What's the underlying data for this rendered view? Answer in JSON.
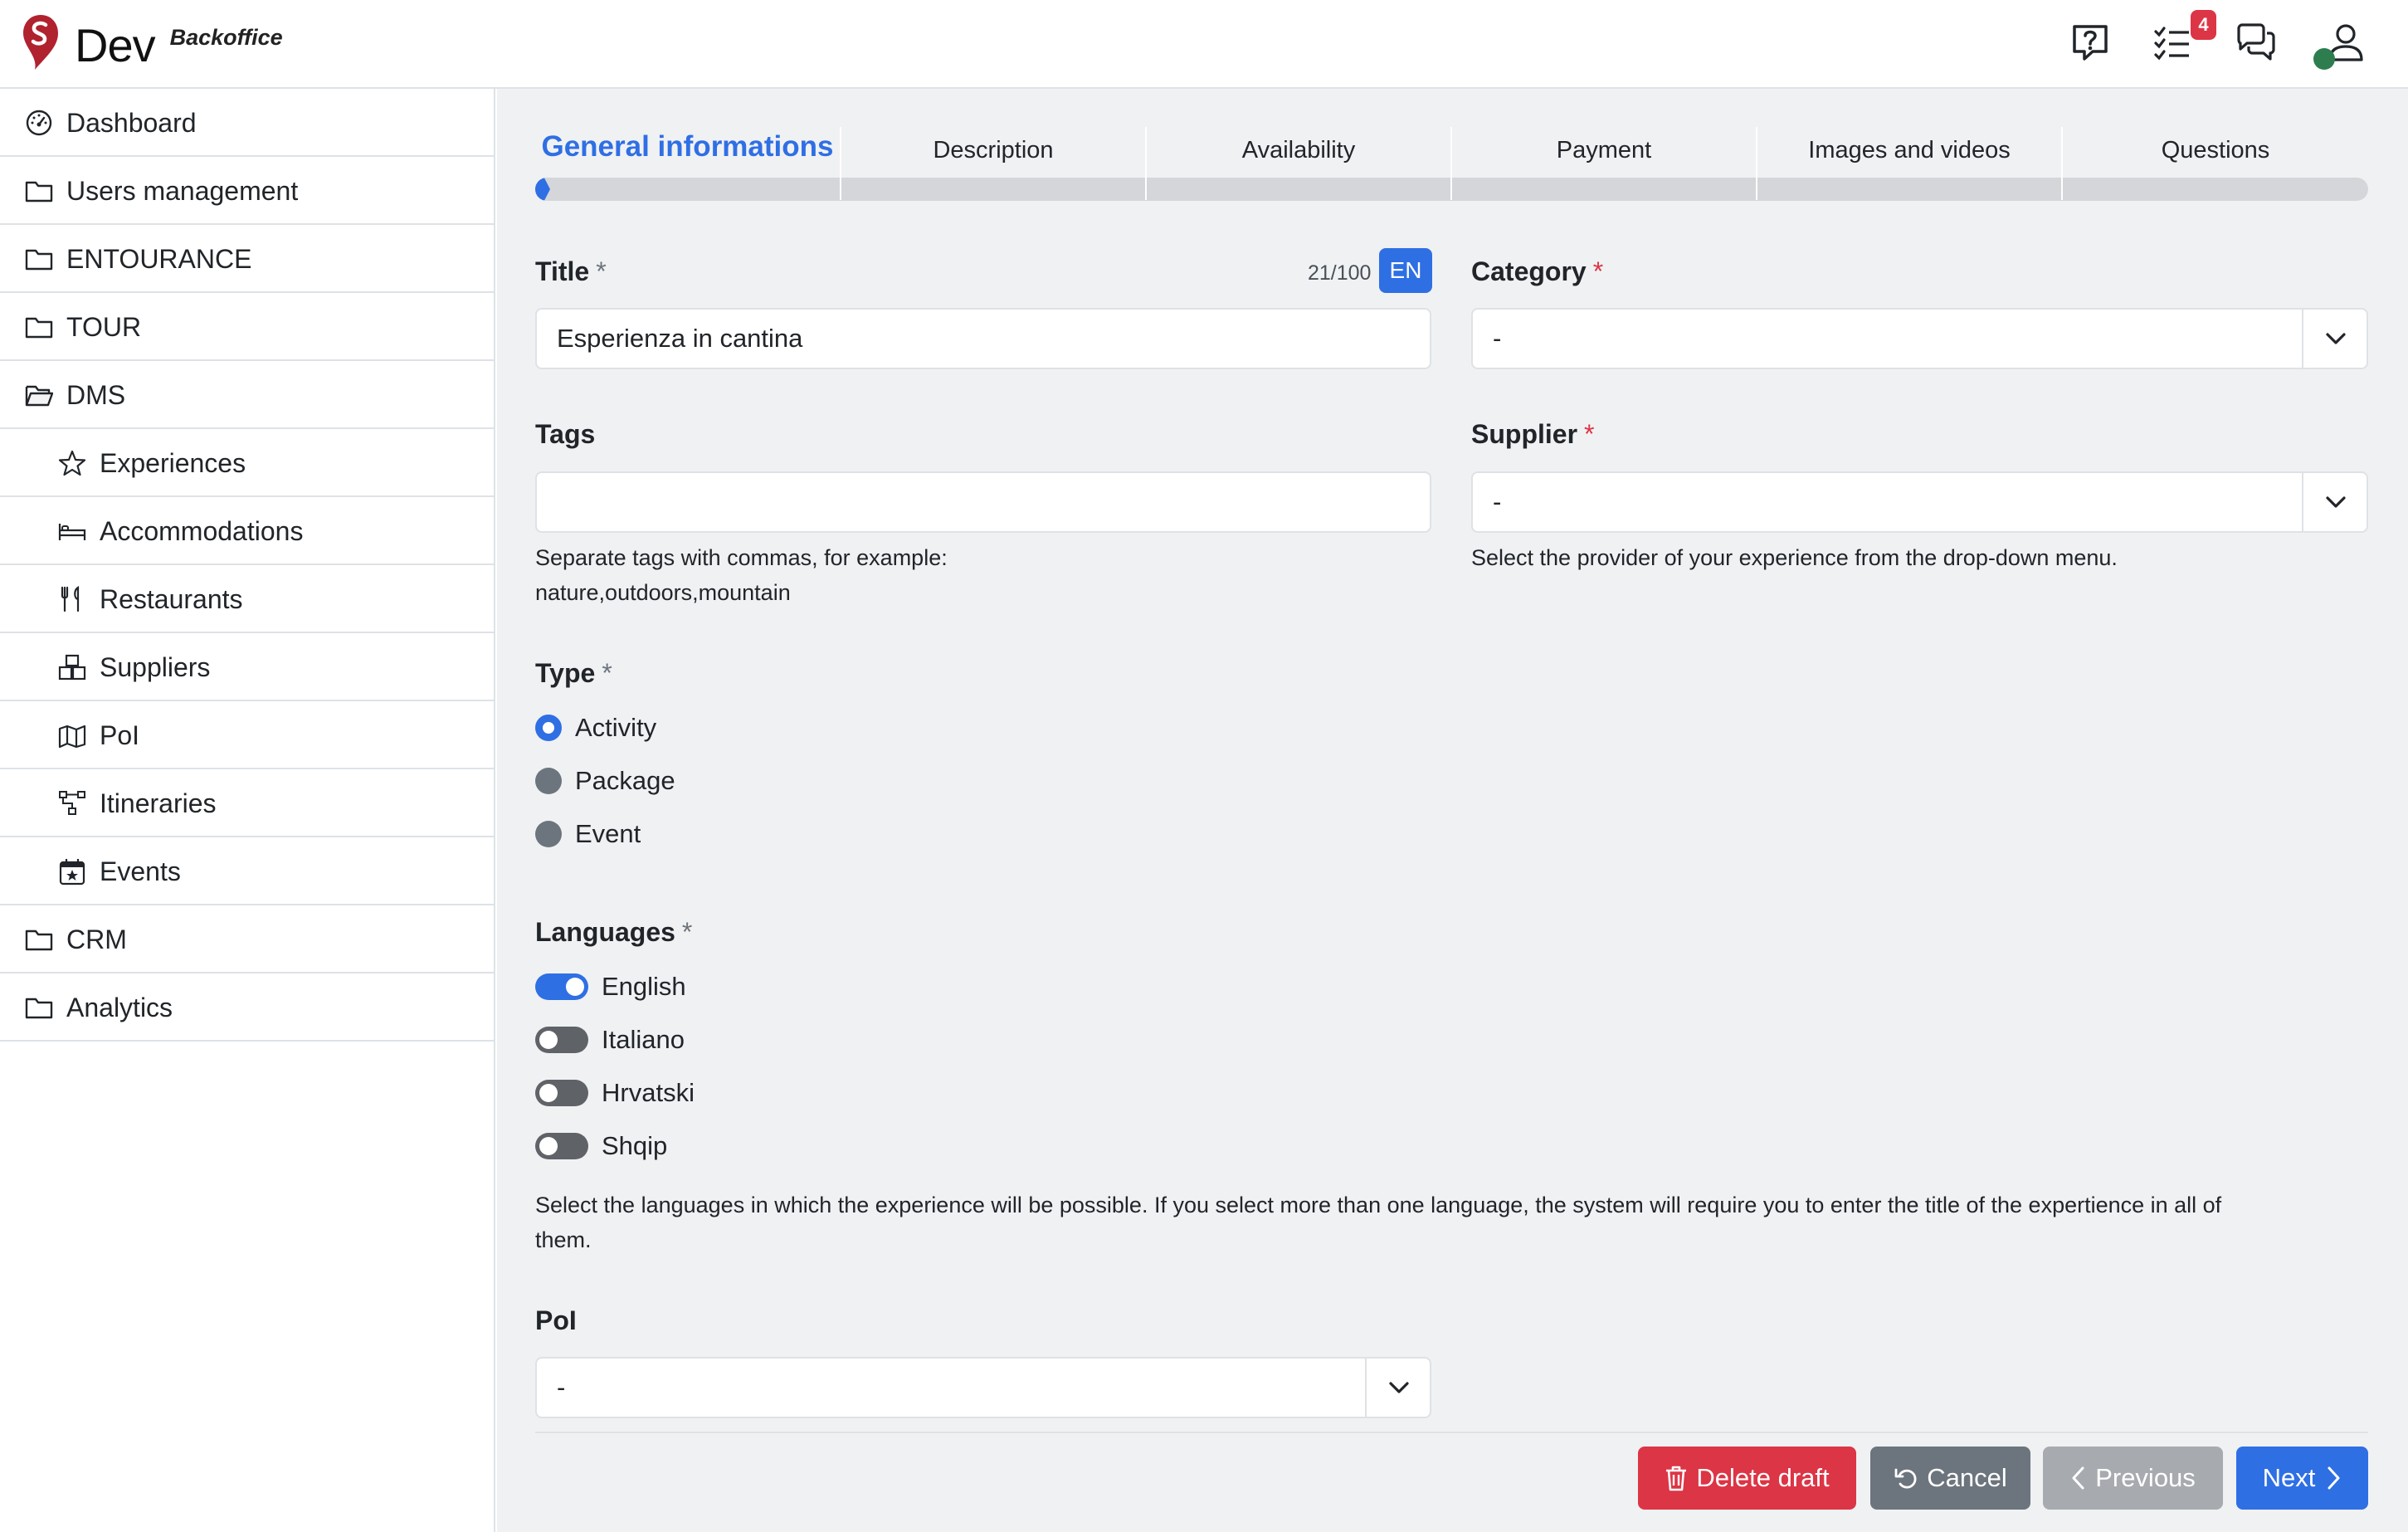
{
  "header": {
    "app_name": "Dev",
    "app_subtitle": "Backoffice",
    "notifications_count": "4",
    "icons": [
      "help-icon",
      "tasks-icon",
      "chat-icon",
      "user-icon"
    ]
  },
  "sidebar": {
    "items": [
      {
        "label": "Dashboard",
        "icon": "speedometer-icon"
      },
      {
        "label": "Users management",
        "icon": "folder-icon"
      },
      {
        "label": "ENTOURANCE",
        "icon": "folder-icon"
      },
      {
        "label": "TOUR",
        "icon": "folder-icon"
      },
      {
        "label": "DMS",
        "icon": "folder-open-icon"
      },
      {
        "label": "Experiences",
        "icon": "star-icon"
      },
      {
        "label": "Accommodations",
        "icon": "bed-icon"
      },
      {
        "label": "Restaurants",
        "icon": "cutlery-icon"
      },
      {
        "label": "Suppliers",
        "icon": "boxes-icon"
      },
      {
        "label": "PoI",
        "icon": "map-icon"
      },
      {
        "label": "Itineraries",
        "icon": "diagram-icon"
      },
      {
        "label": "Events",
        "icon": "calendar-star-icon"
      },
      {
        "label": "CRM",
        "icon": "folder-icon"
      },
      {
        "label": "Analytics",
        "icon": "folder-icon"
      }
    ]
  },
  "tabs": [
    {
      "label": "General informations",
      "active": true
    },
    {
      "label": "Description"
    },
    {
      "label": "Availability"
    },
    {
      "label": "Payment"
    },
    {
      "label": "Images and videos"
    },
    {
      "label": "Questions"
    }
  ],
  "form": {
    "title": {
      "label": "Title",
      "required": "*",
      "counter": "21/100",
      "lang": "EN",
      "value": "Esperienza in cantina"
    },
    "category": {
      "label": "Category",
      "required": "*",
      "value": "-"
    },
    "tags": {
      "label": "Tags",
      "value": "",
      "hint_line1": "Separate tags with commas, for example:",
      "hint_line2": "nature,outdoors,mountain"
    },
    "supplier": {
      "label": "Supplier",
      "required": "*",
      "value": "-",
      "hint": "Select the provider of your experience from the drop-down menu."
    },
    "type": {
      "label": "Type",
      "required": "*",
      "options": [
        "Activity",
        "Package",
        "Event"
      ],
      "selected": "Activity"
    },
    "languages": {
      "label": "Languages",
      "required": "*",
      "options": [
        {
          "label": "English",
          "on": true
        },
        {
          "label": "Italiano",
          "on": false
        },
        {
          "label": "Hrvatski",
          "on": false
        },
        {
          "label": "Shqip",
          "on": false
        }
      ],
      "hint_line1": "Select the languages in which the experience will be possible. If you select more than one language, the system will require you to enter the title of the expertience in all of",
      "hint_line2": "them."
    },
    "poi": {
      "label": "PoI",
      "value": "-"
    }
  },
  "footer": {
    "delete_label": "Delete draft",
    "cancel_label": "Cancel",
    "previous_label": "Previous",
    "next_label": "Next"
  },
  "colors": {
    "primary": "#2f6fe4",
    "danger": "#dc3545",
    "secondary": "#6c757d",
    "logo": "#b0222e"
  }
}
